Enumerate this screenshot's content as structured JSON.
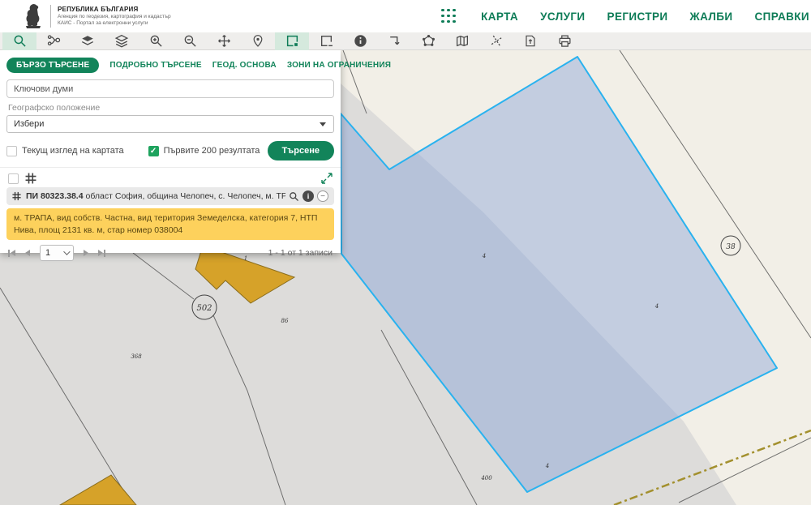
{
  "header": {
    "republic": "РЕПУБЛИКА БЪЛГАРИЯ",
    "agency": "Агенция по геодезия, картография и кадастър",
    "portal": "КАИС - Портал за електронни услуги",
    "nav": [
      "КАРТА",
      "УСЛУГИ",
      "РЕГИСТРИ",
      "ЖАЛБИ",
      "СПРАВКИ"
    ]
  },
  "search_panel": {
    "tabs": [
      "БЪРЗО ТЪРСЕНЕ",
      "ПОДРОБНО ТЪРСЕНЕ",
      "ГЕОД. ОСНОВА",
      "ЗОНИ НА ОГРАНИЧЕНИЯ"
    ],
    "keyword_placeholder": "Ключови думи",
    "geo_label": "Географско положение",
    "geo_value": "Избери",
    "current_view_checkbox": "Текущ изглед на картата",
    "first200_checkbox": "Първите 200 резултата",
    "first200_check_glyph": "✓",
    "search_button": "Търсене",
    "result_id": "ПИ 80323.38.4",
    "result_location": "област София, община Челопеч, с. Челопеч, м. ТРАПА",
    "result_details": "м. ТРАПА, вид собств. Частна, вид територия Земеделска, категория 7, НТП Нива, площ 2131 кв. м, стар номер 038004",
    "info_glyph": "i",
    "minus_glyph": "−",
    "page_value": "1",
    "records_summary": "1 - 1 от 1 записи"
  },
  "map": {
    "labels": {
      "circle_38": "38",
      "circle_502": "502",
      "building_no": "1",
      "n86": "86",
      "n368": "368",
      "n400": "400",
      "parcel_pt": "4"
    },
    "colors": {
      "accent_green": "#0e7c57",
      "parcel_border": "#29b2ef",
      "parcel_fill": "rgba(125,155,215,0.40)",
      "highlight_yellow": "#fdd15c",
      "building_yellow": "#d6a229",
      "zone_beige": "#f2efe7",
      "zone_gray": "#dddcda"
    }
  }
}
